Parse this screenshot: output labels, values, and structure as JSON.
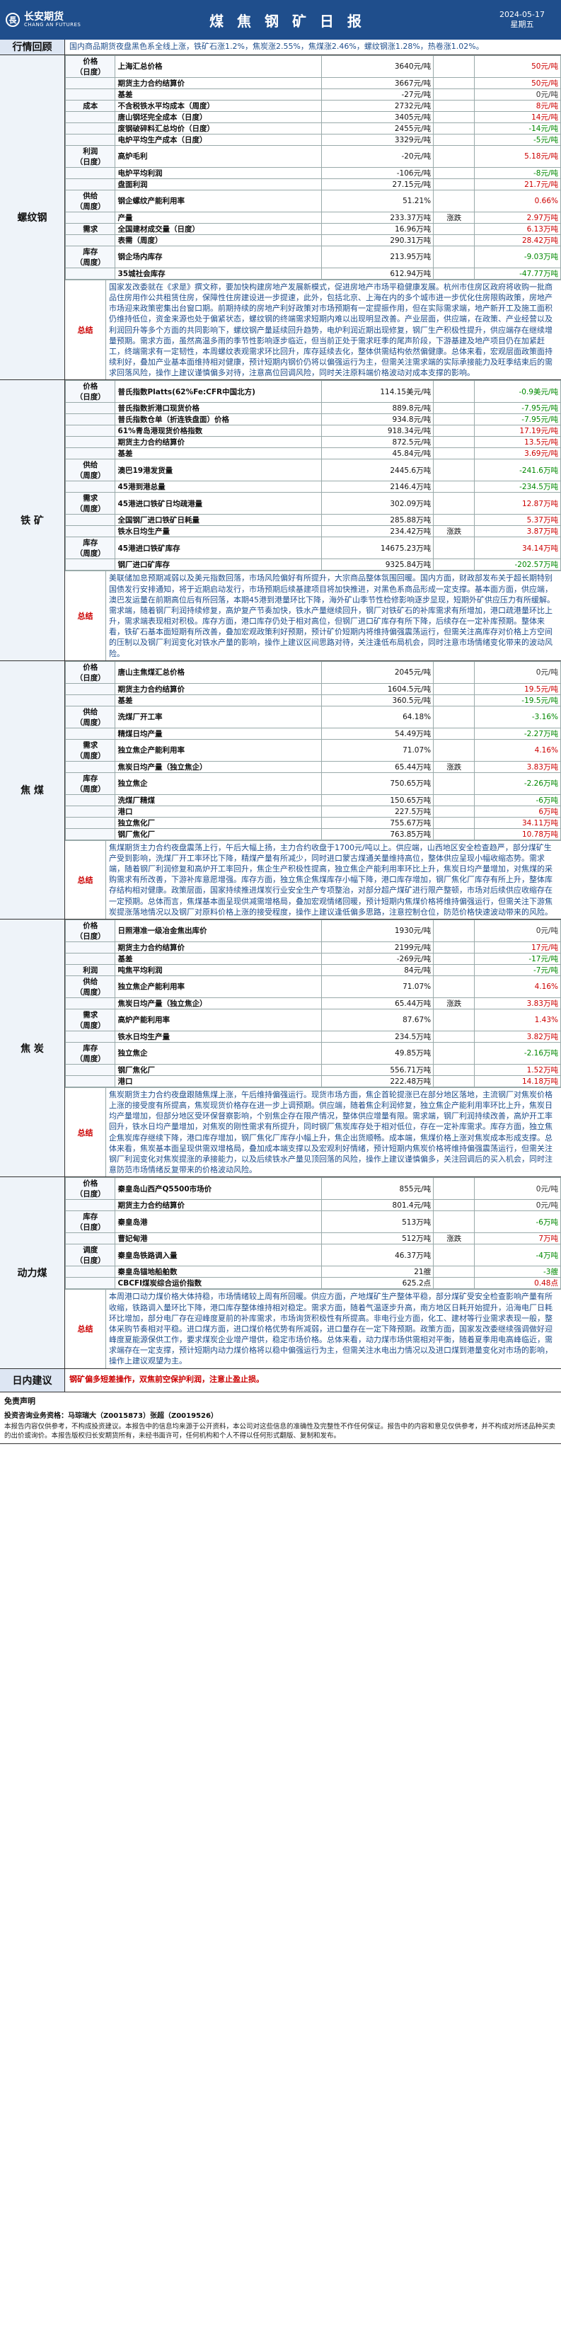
{
  "header": {
    "brand_cn": "长安期货",
    "brand_en": "CHANG AN FUTURES",
    "title": "煤 焦 钢 矿 日 报",
    "date": "2024-05-17",
    "weekday": "星期五"
  },
  "review": {
    "label": "行情回顾",
    "text": "国内商品期货夜盘黑色系全线上涨，铁矿石涨1.2%，焦炭涨2.55%，焦煤涨2.46%，螺纹钢涨1.28%，热卷涨1.02%。"
  },
  "sections": [
    {
      "name": "螺纹钢",
      "rows": [
        {
          "cat": "价格\n（日度）",
          "name": "上海汇总价格",
          "val": "3640元/吨",
          "chg_label": "",
          "chg": "50元/吨",
          "dir": "up"
        },
        {
          "cat": "",
          "name": "期货主力合约结算价",
          "val": "3667元/吨",
          "chg_label": "",
          "chg": "50元/吨",
          "dir": "up"
        },
        {
          "cat": "",
          "name": "基差",
          "val": "-27元/吨",
          "chg_label": "",
          "chg": "0元/吨",
          "dir": "flat"
        },
        {
          "cat": "成本",
          "name": "不含税铁水平均成本（周度）",
          "val": "2732元/吨",
          "chg_label": "",
          "chg": "8元/吨",
          "dir": "up"
        },
        {
          "cat": "",
          "name": "唐山钢坯完全成本（日度）",
          "val": "3405元/吨",
          "chg_label": "",
          "chg": "14元/吨",
          "dir": "up"
        },
        {
          "cat": "",
          "name": "废钢破碎料汇总均价（日度）",
          "val": "2455元/吨",
          "chg_label": "",
          "chg": "-14元/吨",
          "dir": "down"
        },
        {
          "cat": "",
          "name": "电炉平均生产成本（日度）",
          "val": "3329元/吨",
          "chg_label": "",
          "chg": "-5元/吨",
          "dir": "down"
        },
        {
          "cat": "利润\n（日度）",
          "name": "高炉毛利",
          "val": "-20元/吨",
          "chg_label": "",
          "chg": "5.18元/吨",
          "dir": "up"
        },
        {
          "cat": "",
          "name": "电炉平均利润",
          "val": "-106元/吨",
          "chg_label": "",
          "chg": "-8元/吨",
          "dir": "down"
        },
        {
          "cat": "",
          "name": "盘面利润",
          "val": "27.15元/吨",
          "chg_label": "",
          "chg": "21.7元/吨",
          "dir": "up"
        },
        {
          "cat": "供给\n（周度）",
          "name": "钢企螺纹产能利用率",
          "val": "51.21%",
          "chg_label": "",
          "chg": "0.66%",
          "dir": "up"
        },
        {
          "cat": "",
          "name": "产量",
          "val": "233.37万吨",
          "chg_label": "涨跌",
          "chg": "2.97万吨",
          "dir": "up"
        },
        {
          "cat": "需求",
          "name": "全国建材成交量（日度）",
          "val": "16.96万吨",
          "chg_label": "",
          "chg": "6.13万吨",
          "dir": "up"
        },
        {
          "cat": "",
          "name": "表需（周度）",
          "val": "290.31万吨",
          "chg_label": "",
          "chg": "28.42万吨",
          "dir": "up"
        },
        {
          "cat": "库存\n（周度）",
          "name": "钢企场内库存",
          "val": "213.95万吨",
          "chg_label": "",
          "chg": "-9.03万吨",
          "dir": "down"
        },
        {
          "cat": "",
          "name": "35城社会库存",
          "val": "612.94万吨",
          "chg_label": "",
          "chg": "-47.77万吨",
          "dir": "down"
        }
      ],
      "summary_label": "总结",
      "summary": "国家发改委就在《求是》撰文称，要加快构建房地产发展新模式，促进房地产市场平稳健康发展。杭州市住房区政府将收购一批商品住房用作公共租赁住房，保障性住房建设进一步提速，此外，包括北京、上海在内的多个城市进一步优化住房限购政策，房地产市场迎来政策密集出台窗口期。前期持续的房地产利好政策对市场预期有一定提振作用，但在实际需求端，地产新开工及施工面积仍维持低位，资金来源也处于偏紧状态，螺纹钢的终端需求短期内难以出现明显改善。产业层面，供应端，在政策、产业经营以及利润回升等多个方面的共同影响下，螺纹钢产量延续回升趋势，电炉利润近期出现修复，钢厂生产积极性提升，供应端存在继续增量预期。需求方面，虽然高温多雨的季节性影响逐步临近，但当前正处于需求旺季的尾声阶段，下游基建及地产项目仍在加紧赶工，终端需求有一定韧性，本周螺纹表观需求环比回升，库存延续去化，整体供需结构依然偏健康。总体来看，宏观层面政策面持续利好，叠加产业基本面维持相对健康，预计短期内钢价仍将以偏强运行为主，但需关注需求端的实际承接能力及旺季结束后的需求回落风险，操作上建议谨慎偏多对待，注意高位回调风险，同时关注原料端价格波动对成本支撑的影响。"
    },
    {
      "name": "铁 矿",
      "rows": [
        {
          "cat": "价格\n（日度）",
          "name": "普氏指数Platts(62%Fe:CFR中国北方)",
          "val": "114.15美元/吨",
          "chg_label": "",
          "chg": "-0.9美元/吨",
          "dir": "down"
        },
        {
          "cat": "",
          "name": "普氏指数折港口现货价格",
          "val": "889.8元/吨",
          "chg_label": "",
          "chg": "-7.95元/吨",
          "dir": "down"
        },
        {
          "cat": "",
          "name": "普氏指数仓单（折连铁盘面）价格",
          "val": "934.8元/吨",
          "chg_label": "",
          "chg": "-7.95元/吨",
          "dir": "down"
        },
        {
          "cat": "",
          "name": "61%青岛港现货价格指数",
          "val": "918.34元/吨",
          "chg_label": "",
          "chg": "17.19元/吨",
          "dir": "up"
        },
        {
          "cat": "",
          "name": "期货主力合约结算价",
          "val": "872.5元/吨",
          "chg_label": "",
          "chg": "13.5元/吨",
          "dir": "up"
        },
        {
          "cat": "",
          "name": "基差",
          "val": "45.84元/吨",
          "chg_label": "",
          "chg": "3.69元/吨",
          "dir": "up"
        },
        {
          "cat": "供给\n（周度）",
          "name": "澳巴19港发货量",
          "val": "2445.6万吨",
          "chg_label": "",
          "chg": "-241.6万吨",
          "dir": "down"
        },
        {
          "cat": "",
          "name": "45港到港总量",
          "val": "2146.4万吨",
          "chg_label": "",
          "chg": "-234.5万吨",
          "dir": "down"
        },
        {
          "cat": "需求\n（周度）",
          "name": "45港进口铁矿日均疏港量",
          "val": "302.09万吨",
          "chg_label": "",
          "chg": "12.87万吨",
          "dir": "up"
        },
        {
          "cat": "",
          "name": "全国钢厂进口铁矿日耗量",
          "val": "285.88万吨",
          "chg_label": "",
          "chg": "5.37万吨",
          "dir": "up"
        },
        {
          "cat": "",
          "name": "铁水日均生产量",
          "val": "234.42万吨",
          "chg_label": "涨跌",
          "chg": "3.87万吨",
          "dir": "up"
        },
        {
          "cat": "库存\n（周度）",
          "name": "45港进口铁矿库存",
          "val": "14675.23万吨",
          "chg_label": "",
          "chg": "34.14万吨",
          "dir": "up"
        },
        {
          "cat": "",
          "name": "钢厂进口矿库存",
          "val": "9325.84万吨",
          "chg_label": "",
          "chg": "-202.57万吨",
          "dir": "down"
        }
      ],
      "summary_label": "总结",
      "summary": "美联储加息预期减弱以及美元指数回落，市场风险偏好有所提升，大宗商品整体氛围回暖。国内方面，财政部发布关于超长期特别国债发行安排通知，将于近期启动发行，市场预期后续基建项目将加快推进，对黑色系商品形成一定支撑。基本面方面，供应端，澳巴发运量在前期高位后有所回落，本期45港到港量环比下降，海外矿山季节性检修影响逐步显现，短期外矿供应压力有所缓解。需求端，随着钢厂利润持续修复，高炉复产节奏加快，铁水产量继续回升，钢厂对铁矿石的补库需求有所增加，港口疏港量环比上升，需求端表现相对积极。库存方面，港口库存仍处于相对高位，但钢厂进口矿库存有所下降，后续存在一定补库预期。整体来看，铁矿石基本面短期有所改善，叠加宏观政策利好预期，预计矿价短期内将维持偏强震荡运行，但需关注高库存对价格上方空间的压制以及钢厂利润变化对铁水产量的影响，操作上建议区间思路对待，关注逢低布局机会，同时注意市场情绪变化带来的波动风险。"
    },
    {
      "name": "焦 煤",
      "rows": [
        {
          "cat": "价格\n（日度）",
          "name": "唐山主焦煤汇总价格",
          "val": "2045元/吨",
          "chg_label": "",
          "chg": "0元/吨",
          "dir": "flat"
        },
        {
          "cat": "",
          "name": "期货主力合约结算价",
          "val": "1604.5元/吨",
          "chg_label": "",
          "chg": "19.5元/吨",
          "dir": "up"
        },
        {
          "cat": "",
          "name": "基差",
          "val": "360.5元/吨",
          "chg_label": "",
          "chg": "-19.5元/吨",
          "dir": "down"
        },
        {
          "cat": "供给\n（周度）",
          "name": "洗煤厂开工率",
          "val": "64.18%",
          "chg_label": "",
          "chg": "-3.16%",
          "dir": "down"
        },
        {
          "cat": "",
          "name": "精煤日均产量",
          "val": "54.49万吨",
          "chg_label": "",
          "chg": "-2.27万吨",
          "dir": "down"
        },
        {
          "cat": "需求\n（周度）",
          "name": "独立焦企产能利用率",
          "val": "71.07%",
          "chg_label": "",
          "chg": "4.16%",
          "dir": "up"
        },
        {
          "cat": "",
          "name": "焦炭日均产量（独立焦企）",
          "val": "65.44万吨",
          "chg_label": "涨跌",
          "chg": "3.83万吨",
          "dir": "up"
        },
        {
          "cat": "库存\n（周度）",
          "name": "独立焦企",
          "val": "750.65万吨",
          "chg_label": "",
          "chg": "-2.26万吨",
          "dir": "down"
        },
        {
          "cat": "",
          "name": "洗煤厂精煤",
          "val": "150.65万吨",
          "chg_label": "",
          "chg": "-6万吨",
          "dir": "down"
        },
        {
          "cat": "",
          "name": "港口",
          "val": "227.5万吨",
          "chg_label": "",
          "chg": "6万吨",
          "dir": "up"
        },
        {
          "cat": "",
          "name": "独立焦化厂",
          "val": "755.67万吨",
          "chg_label": "",
          "chg": "34.11万吨",
          "dir": "up"
        },
        {
          "cat": "",
          "name": "钢厂焦化厂",
          "val": "763.85万吨",
          "chg_label": "",
          "chg": "10.78万吨",
          "dir": "up"
        }
      ],
      "summary_label": "总结",
      "summary": "焦煤期货主力合约夜盘震荡上行，午后大幅上扬，主力合约收盘于1700元/吨以上。供应端，山西地区安全检查趋严，部分煤矿生产受到影响，洗煤厂开工率环比下降，精煤产量有所减少，同时进口蒙古煤通关量维持高位，整体供应呈现小幅收缩态势。需求端，随着钢厂利润修复和高炉开工率回升，焦企生产积极性提高，独立焦企产能利用率环比上升，焦炭日均产量增加，对焦煤的采购需求有所改善，下游补库意愿增强。库存方面，独立焦企焦煤库存小幅下降，港口库存增加，钢厂焦化厂库存有所上升，整体库存结构相对健康。政策层面，国家持续推进煤炭行业安全生产专项整治，对部分超产煤矿进行限产整顿，市场对后续供应收缩存在一定预期。总体而言，焦煤基本面呈现供减需增格局，叠加宏观情绪回暖，预计短期内焦煤价格将维持偏强运行，但需关注下游焦炭提涨落地情况以及钢厂对原料价格上涨的接受程度，操作上建议逢低偏多思路，注意控制仓位，防范价格快速波动带来的风险。"
    },
    {
      "name": "焦 炭",
      "rows": [
        {
          "cat": "价格\n（日度）",
          "name": "日照港准一级冶金焦出库价",
          "val": "1930元/吨",
          "chg_label": "",
          "chg": "0元/吨",
          "dir": "flat"
        },
        {
          "cat": "",
          "name": "期货主力合约结算价",
          "val": "2199元/吨",
          "chg_label": "",
          "chg": "17元/吨",
          "dir": "up"
        },
        {
          "cat": "",
          "name": "基差",
          "val": "-269元/吨",
          "chg_label": "",
          "chg": "-17元/吨",
          "dir": "down"
        },
        {
          "cat": "利润",
          "name": "吨焦平均利润",
          "val": "84元/吨",
          "chg_label": "",
          "chg": "-7元/吨",
          "dir": "down"
        },
        {
          "cat": "供给\n（周度）",
          "name": "独立焦企产能利用率",
          "val": "71.07%",
          "chg_label": "",
          "chg": "4.16%",
          "dir": "up"
        },
        {
          "cat": "",
          "name": "焦炭日均产量（独立焦企）",
          "val": "65.44万吨",
          "chg_label": "涨跌",
          "chg": "3.83万吨",
          "dir": "up"
        },
        {
          "cat": "需求\n（周度）",
          "name": "高炉产能利用率",
          "val": "87.67%",
          "chg_label": "",
          "chg": "1.43%",
          "dir": "up"
        },
        {
          "cat": "",
          "name": "铁水日均生产量",
          "val": "234.5万吨",
          "chg_label": "",
          "chg": "3.82万吨",
          "dir": "up"
        },
        {
          "cat": "库存\n（周度）",
          "name": "独立焦企",
          "val": "49.85万吨",
          "chg_label": "",
          "chg": "-2.16万吨",
          "dir": "down"
        },
        {
          "cat": "",
          "name": "钢厂焦化厂",
          "val": "556.71万吨",
          "chg_label": "",
          "chg": "1.52万吨",
          "dir": "up"
        },
        {
          "cat": "",
          "name": "港口",
          "val": "222.48万吨",
          "chg_label": "",
          "chg": "14.18万吨",
          "dir": "up"
        }
      ],
      "summary_label": "总结",
      "summary": "焦炭期货主力合约夜盘跟随焦煤上涨，午后维持偏强运行。现货市场方面，焦企首轮提涨已在部分地区落地，主流钢厂对焦炭价格上涨的接受度有所提高，焦炭现货价格存在进一步上调预期。供应端，随着焦企利润修复，独立焦企产能利用率环比上升，焦炭日均产量增加，但部分地区受环保督察影响，个别焦企存在限产情况，整体供应增量有限。需求端，钢厂利润持续改善，高炉开工率回升，铁水日均产量增加，对焦炭的刚性需求有所提升，同时钢厂焦炭库存处于相对低位，存在一定补库需求。库存方面，独立焦企焦炭库存继续下降，港口库存增加，钢厂焦化厂库存小幅上升，焦企出货顺畅。成本端，焦煤价格上涨对焦炭成本形成支撑。总体来看，焦炭基本面呈现供需双增格局，叠加成本端支撑以及宏观利好情绪，预计短期内焦炭价格将维持偏强震荡运行，但需关注钢厂利润变化对焦炭提涨的承接能力，以及后续铁水产量见顶回落的风险，操作上建议谨慎偏多，关注回调后的买入机会，同时注意防范市场情绪反复带来的价格波动风险。"
    },
    {
      "name": "动力煤",
      "rows": [
        {
          "cat": "价格\n（日度）",
          "name": "秦皇岛山西产Q5500市场价",
          "val": "855元/吨",
          "chg_label": "",
          "chg": "0元/吨",
          "dir": "flat"
        },
        {
          "cat": "",
          "name": "期货主力合约结算价",
          "val": "801.4元/吨",
          "chg_label": "",
          "chg": "0元/吨",
          "dir": "flat"
        },
        {
          "cat": "库存\n（日度）",
          "name": "秦皇岛港",
          "val": "513万吨",
          "chg_label": "",
          "chg": "-6万吨",
          "dir": "down"
        },
        {
          "cat": "",
          "name": "曹妃甸港",
          "val": "512万吨",
          "chg_label": "涨跌",
          "chg": "7万吨",
          "dir": "up"
        },
        {
          "cat": "调度\n（日度）",
          "name": "秦皇岛铁路调入量",
          "val": "46.37万吨",
          "chg_label": "",
          "chg": "-4万吨",
          "dir": "down"
        },
        {
          "cat": "",
          "name": "秦皇岛锚地船舶数",
          "val": "21艘",
          "chg_label": "",
          "chg": "-3艘",
          "dir": "down"
        },
        {
          "cat": "",
          "name": "CBCFI煤炭综合运价指数",
          "val": "625.2点",
          "chg_label": "",
          "chg": "0.48点",
          "dir": "up"
        }
      ],
      "summary_label": "总结",
      "summary": "本周港口动力煤价格大体持稳，市场情绪较上周有所回暖。供应方面，产地煤矿生产整体平稳，部分煤矿受安全检查影响产量有所收缩，铁路调入量环比下降，港口库存整体维持相对稳定。需求方面，随着气温逐步升高，南方地区日耗开始提升，沿海电厂日耗环比增加，部分电厂存在迎峰度夏前的补库需求，市场询货积极性有所提高。非电行业方面，化工、建材等行业需求表现一般，整体采购节奏相对平稳。进口煤方面，进口煤价格优势有所减弱，进口量存在一定下降预期。政策方面，国家发改委继续强调做好迎峰度夏能源保供工作，要求煤炭企业增产增供，稳定市场价格。总体来看，动力煤市场供需相对平衡，随着夏季用电高峰临近，需求端存在一定支撑，预计短期内动力煤价格将以稳中偏强运行为主，但需关注水电出力情况以及进口煤到港量变化对市场的影响，操作上建议观望为主。"
    }
  ],
  "advice": {
    "label": "日内建议",
    "text": "钢矿偏多短差操作，双焦前空保护利润，注意止盈止损。"
  },
  "disclaimer": {
    "title": "免责声明",
    "line1": "投资咨询业务资格：马琮瑞大（Z0015873）张超（Z0019526）",
    "text": "本报告内容仅供参考，不构成投资建议。本报告中的信息均来源于公开资料，本公司对这些信息的准确性及完整性不作任何保证。报告中的内容和意见仅供参考，并不构成对所述品种买卖的出价或询价。本报告版权归长安期货所有，未经书面许可，任何机构和个人不得以任何形式翻版、复制和发布。"
  }
}
